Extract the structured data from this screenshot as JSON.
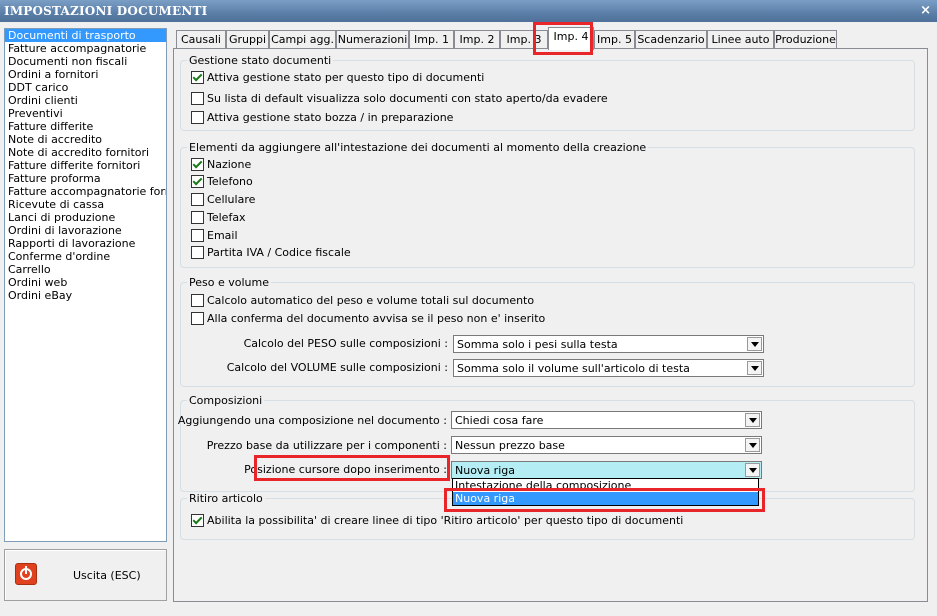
{
  "window": {
    "title": "IMPOSTAZIONI DOCUMENTI",
    "close_glyph": "×"
  },
  "left_list": {
    "selected_index": 0,
    "items": [
      "Documenti di trasporto",
      "Fatture accompagnatorie",
      "Documenti non fiscali",
      "Ordini a fornitori",
      "DDT carico",
      "Ordini clienti",
      "Preventivi",
      "Fatture differite",
      "Note di accredito",
      "Note di accredito fornitori",
      "Fatture differite fornitori",
      "Fatture proforma",
      "Fatture accompagnatorie fornito",
      "Ricevute di cassa",
      "Lanci di produzione",
      "Ordini di lavorazione",
      "Rapporti di lavorazione",
      "Conferme d'ordine",
      "Carrello",
      "Ordini web",
      "Ordini eBay"
    ]
  },
  "exit_button": {
    "label": "Uscita (ESC)",
    "icon": "power-icon",
    "color": "#e0421f"
  },
  "tabs": [
    "Causali",
    "Gruppi",
    "Campi agg.",
    "Numerazioni",
    "Imp. 1",
    "Imp. 2",
    "Imp. 3",
    "Imp. 4",
    "Imp. 5",
    "Scadenzario",
    "Linee auto",
    "Produzione"
  ],
  "active_tab": "Imp. 4",
  "stato": {
    "legend": "Gestione stato documenti",
    "options": [
      {
        "label": "Attiva gestione stato per questo tipo di documenti",
        "checked": true
      },
      {
        "label": "Su lista di default visualizza solo documenti con stato aperto/da evadere",
        "checked": false
      },
      {
        "label": "Attiva gestione stato bozza / in preparazione",
        "checked": false
      }
    ]
  },
  "intestazione": {
    "legend": "Elementi da aggiungere all'intestazione dei documenti al momento della creazione",
    "options": [
      {
        "label": "Nazione",
        "checked": true
      },
      {
        "label": "Telefono",
        "checked": true
      },
      {
        "label": "Cellulare",
        "checked": false
      },
      {
        "label": "Telefax",
        "checked": false
      },
      {
        "label": "Email",
        "checked": false
      },
      {
        "label": "Partita IVA / Codice fiscale",
        "checked": false
      }
    ]
  },
  "peso": {
    "legend": "Peso e volume",
    "options": [
      {
        "label": "Calcolo automatico del peso e volume totali sul documento",
        "checked": false
      },
      {
        "label": "Alla conferma del documento avvisa se il peso non e' inserito",
        "checked": false
      }
    ],
    "calc_peso_label": "Calcolo del PESO sulle composizioni :",
    "calc_peso_value": "Somma solo i pesi sulla testa",
    "calc_volume_label": "Calcolo del VOLUME sulle composizioni :",
    "calc_volume_value": "Somma solo il volume sull'articolo di testa"
  },
  "composizioni": {
    "legend": "Composizioni",
    "aggiungendo_label": "Aggiungendo una composizione nel documento :",
    "aggiungendo_value": "Chiedi cosa fare",
    "prezzo_label": "Prezzo base da utilizzare per i componenti :",
    "prezzo_value": "Nessun prezzo base",
    "posizione_label": "Posizione cursore dopo inserimento :",
    "posizione_value": "Nuova riga",
    "posizione_options": [
      "Intestazione della composizione",
      "Nuova riga"
    ],
    "posizione_highlighted": "Nuova riga"
  },
  "ritiro": {
    "legend": "Ritiro articolo",
    "option": {
      "label": "Abilita la possibilita' di creare linee di tipo 'Ritiro articolo' per questo tipo di documenti",
      "checked": true
    }
  },
  "colors": {
    "highlight": "#3399ff",
    "annotation_red": "#e8262a",
    "combo_active": "#b4eef4"
  }
}
